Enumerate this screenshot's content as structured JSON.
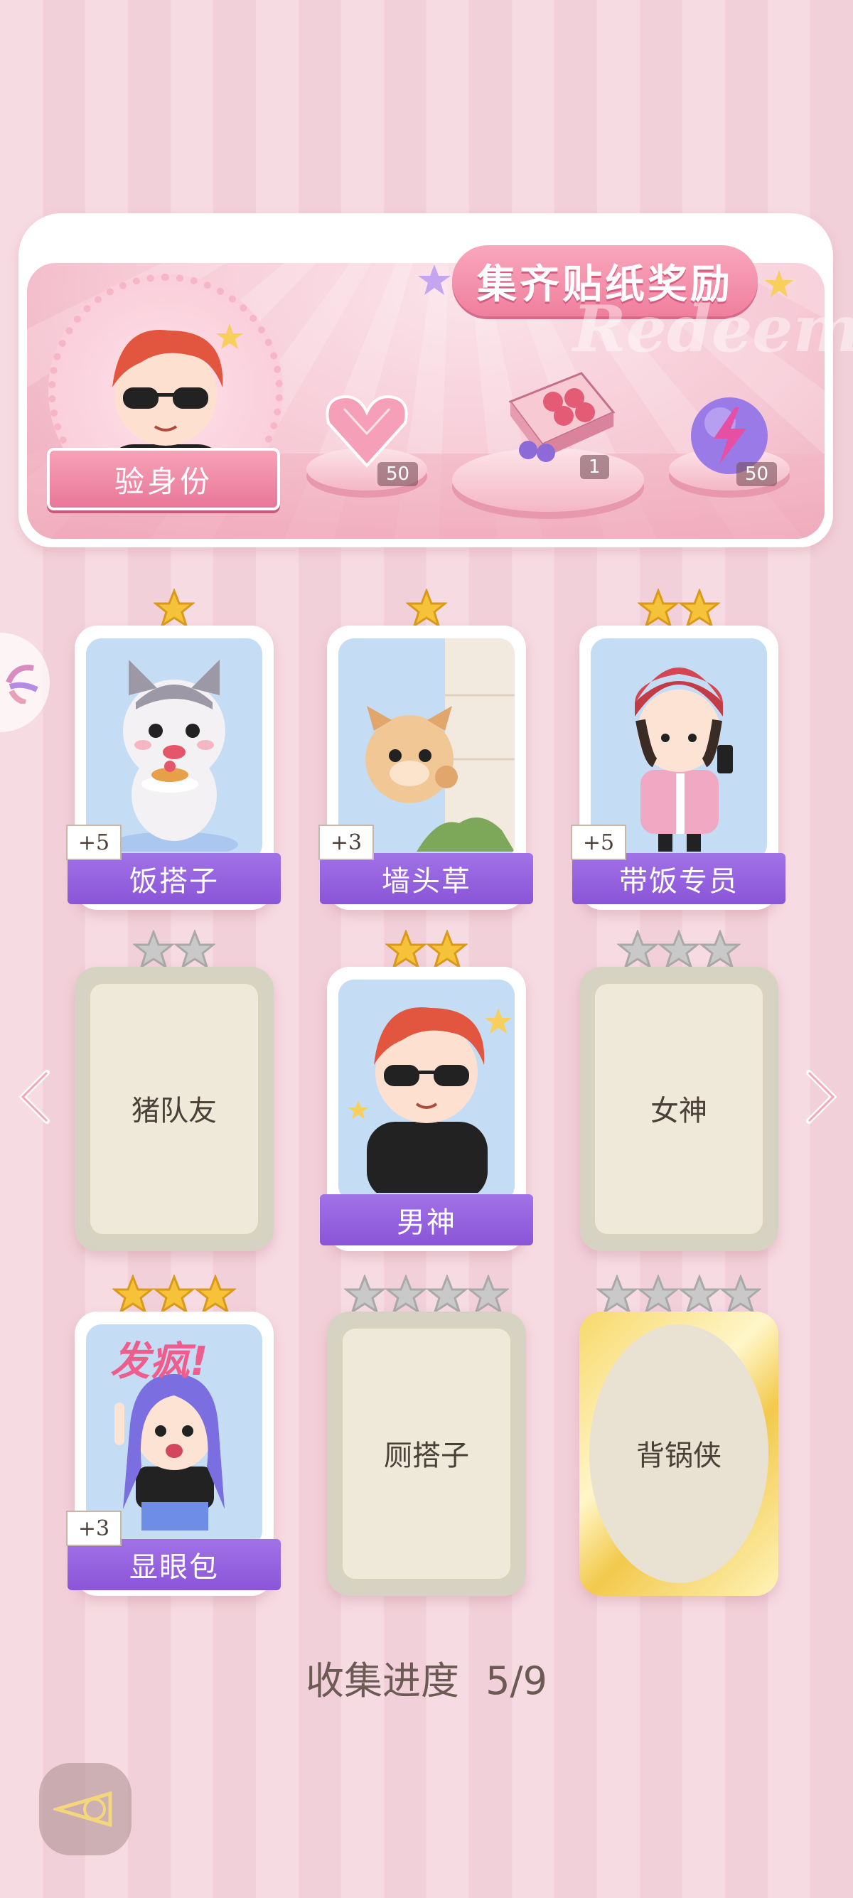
{
  "banner": {
    "title": "集齐贴纸奖励",
    "watermark": "Redeem",
    "verify_button": "验身份",
    "rewards": [
      {
        "icon": "pink-heart-gem-icon",
        "count": "50"
      },
      {
        "icon": "gift-box-icon",
        "count": "1"
      },
      {
        "icon": "lightning-orb-icon",
        "count": "50"
      }
    ]
  },
  "cards": [
    {
      "name": "饭搭子",
      "stars": 1,
      "max_stars": 1,
      "bonus": "+5",
      "state": "unlocked",
      "pic": "cat-icon"
    },
    {
      "name": "墙头草",
      "stars": 1,
      "max_stars": 1,
      "bonus": "+3",
      "state": "unlocked",
      "pic": "squirrel-icon"
    },
    {
      "name": "带饭专员",
      "stars": 2,
      "max_stars": 2,
      "bonus": "+5",
      "state": "unlocked",
      "pic": "girl-phone-icon"
    },
    {
      "name": "猪队友",
      "stars": 0,
      "max_stars": 2,
      "bonus": "",
      "state": "locked",
      "pic": ""
    },
    {
      "name": "男神",
      "stars": 2,
      "max_stars": 2,
      "bonus": "",
      "state": "unlocked",
      "pic": "boy-sunglasses-icon"
    },
    {
      "name": "女神",
      "stars": 0,
      "max_stars": 3,
      "bonus": "",
      "state": "locked",
      "pic": ""
    },
    {
      "name": "显眼包",
      "stars": 3,
      "max_stars": 3,
      "bonus": "+3",
      "state": "unlocked",
      "pic": "crazy-girl-icon",
      "pic_caption": "发疯!"
    },
    {
      "name": "厕搭子",
      "stars": 0,
      "max_stars": 4,
      "bonus": "",
      "state": "locked",
      "pic": ""
    },
    {
      "name": "背锅侠",
      "stars": 0,
      "max_stars": 4,
      "bonus": "",
      "state": "gold",
      "pic": ""
    }
  ],
  "progress": {
    "label": "收集进度",
    "value": "5/9"
  },
  "colors": {
    "accent_purple": "#8a55d8",
    "banner_pink": "#f6c9d5",
    "star_gold": "#f5c23a",
    "star_grey": "#c9c9c9"
  }
}
